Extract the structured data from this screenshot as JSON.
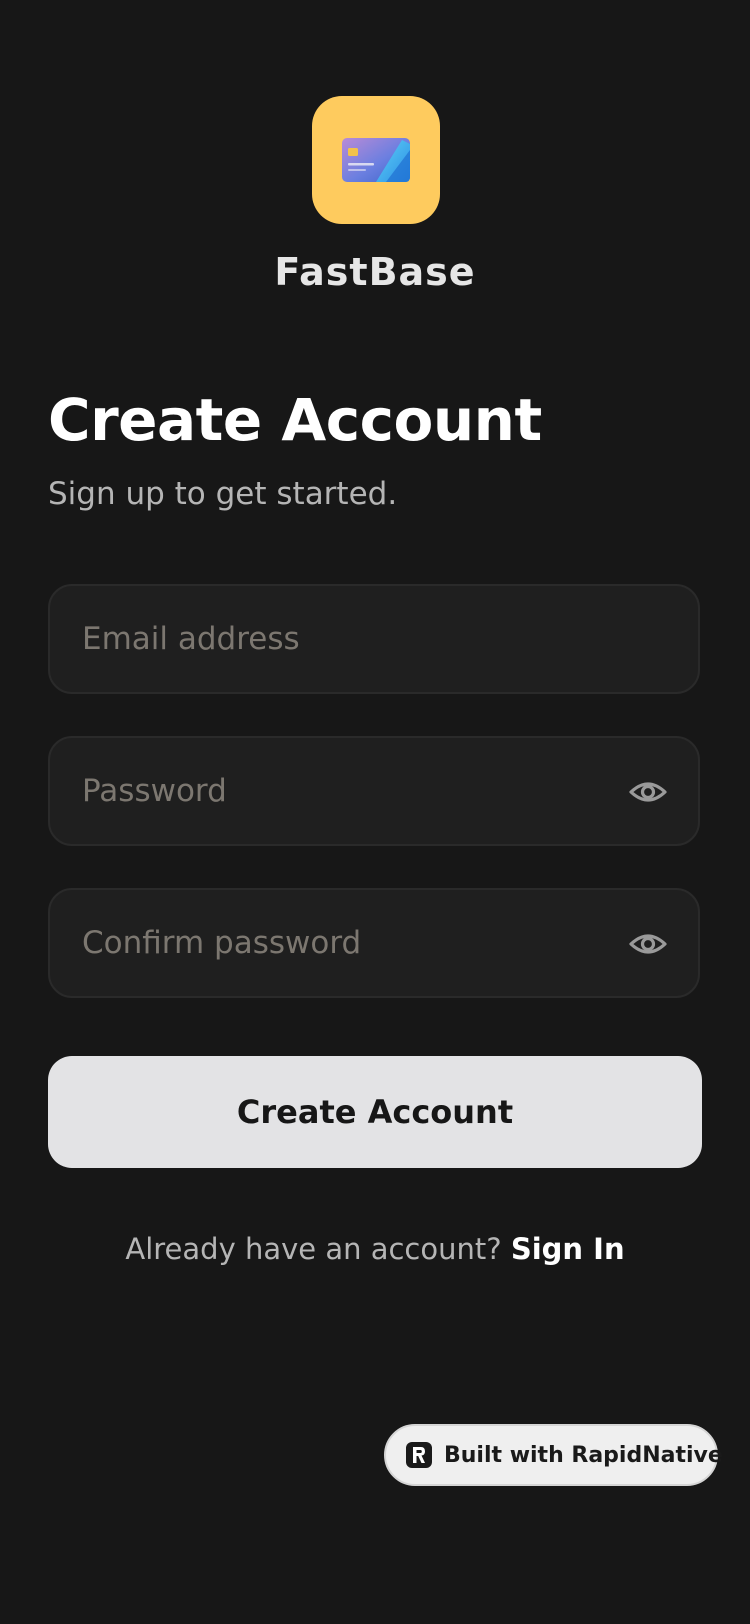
{
  "app": {
    "brand_name": "FastBase",
    "logo_icon": "credit-card-icon",
    "colors": {
      "background": "#171717",
      "logo_tile": "#fecb5e",
      "field_background": "#1f1f1f",
      "primary_button": "#e3e3e5",
      "placeholder": "#7c7770"
    }
  },
  "header": {
    "title": "Create Account",
    "subtitle": "Sign up to get started."
  },
  "form": {
    "email": {
      "placeholder": "Email address",
      "value": ""
    },
    "password": {
      "placeholder": "Password",
      "value": "",
      "toggle_icon": "eye-icon"
    },
    "confirm_password": {
      "placeholder": "Confirm password",
      "value": "",
      "toggle_icon": "eye-icon"
    },
    "submit_label": "Create Account"
  },
  "footer": {
    "prompt": "Already have an account?",
    "link_label": "Sign In"
  },
  "badge": {
    "label": "Built with RapidNative",
    "icon": "rapidnative-logo-icon"
  }
}
